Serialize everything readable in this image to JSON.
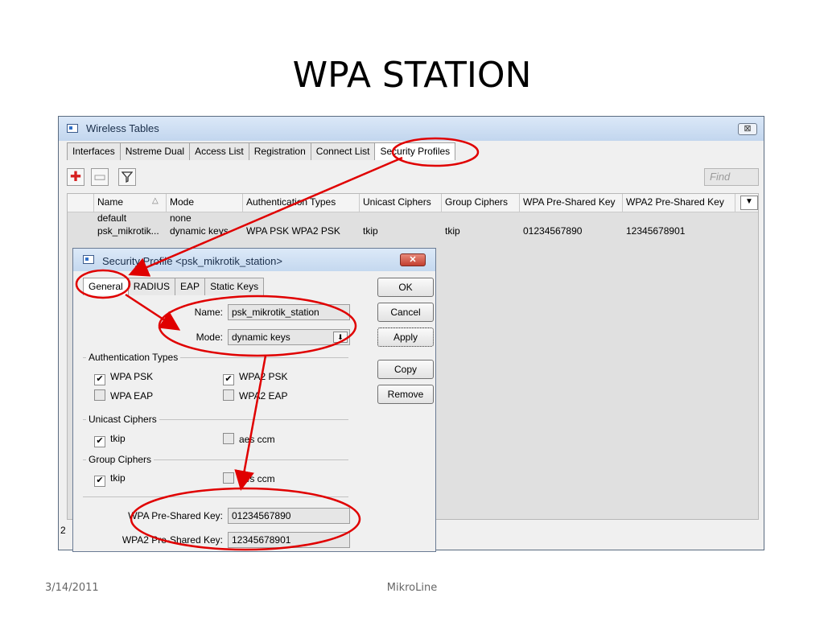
{
  "slide": {
    "title": "WPA STATION",
    "date": "3/14/2011",
    "footer": "MikroLine"
  },
  "wireless_tables": {
    "title": "Wireless Tables",
    "close_glyph": "⊠",
    "tabs": [
      "Interfaces",
      "Nstreme Dual",
      "Access List",
      "Registration",
      "Connect List",
      "Security Profiles"
    ],
    "active_tab": "Security Profiles",
    "toolbar": {
      "add_glyph": "✚",
      "remove_glyph": "▭",
      "filter_glyph": "⏷",
      "find_placeholder": "Find"
    },
    "columns": [
      "Name",
      "Mode",
      "Authentication Types",
      "Unicast Ciphers",
      "Group Ciphers",
      "WPA Pre-Shared Key",
      "WPA2 Pre-Shared Key"
    ],
    "sort_glyph": "△",
    "menu_glyph": "▼",
    "rows": [
      {
        "name": "default",
        "mode": "none",
        "auth": "",
        "unicast": "",
        "group": "",
        "wpa_key": "",
        "wpa2_key": ""
      },
      {
        "name": "psk_mikrotik...",
        "mode": "dynamic keys",
        "auth": "WPA PSK WPA2 PSK",
        "unicast": "tkip",
        "group": "tkip",
        "wpa_key": "01234567890",
        "wpa2_key": "12345678901"
      }
    ],
    "status_count": "2"
  },
  "security_profile": {
    "title": "Security Profile <psk_mikrotik_station>",
    "close_glyph": "✕",
    "tabs": [
      "General",
      "RADIUS",
      "EAP",
      "Static Keys"
    ],
    "active_tab": "General",
    "name_label": "Name:",
    "name_value": "psk_mikrotik_station",
    "mode_label": "Mode:",
    "mode_value": "dynamic keys",
    "dropdown_glyph": "⬇",
    "auth_group": "Authentication Types",
    "auth_options": [
      {
        "label": "WPA PSK",
        "checked": true
      },
      {
        "label": "WPA2 PSK",
        "checked": true
      },
      {
        "label": "WPA EAP",
        "checked": false
      },
      {
        "label": "WPA2 EAP",
        "checked": false
      }
    ],
    "unicast_group": "Unicast Ciphers",
    "unicast_options": [
      {
        "label": "tkip",
        "checked": true
      },
      {
        "label": "aes ccm",
        "checked": false
      }
    ],
    "group_group": "Group Ciphers",
    "group_options": [
      {
        "label": "tkip",
        "checked": true
      },
      {
        "label": "aes ccm",
        "checked": false
      }
    ],
    "wpa_key_label": "WPA Pre-Shared Key:",
    "wpa_key_value": "01234567890",
    "wpa2_key_label": "WPA2 Pre-Shared Key:",
    "wpa2_key_value": "12345678901",
    "buttons": {
      "ok": "OK",
      "cancel": "Cancel",
      "apply": "Apply",
      "copy": "Copy",
      "remove": "Remove"
    },
    "check_glyph": "✔"
  },
  "colors": {
    "annotation": "#e00000",
    "title_bar": "#c4d8ef"
  }
}
